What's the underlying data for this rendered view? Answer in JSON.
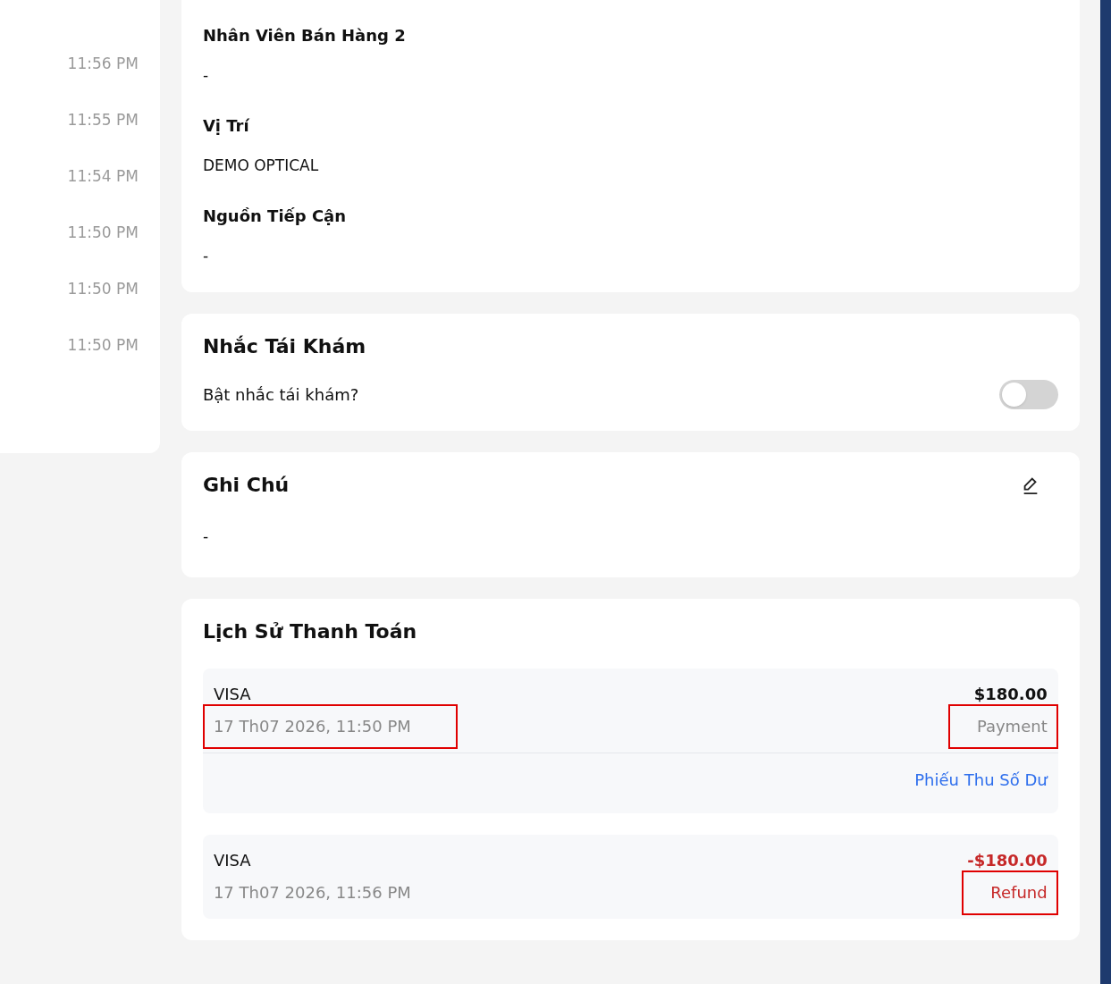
{
  "timeline": {
    "times": [
      "11:56 PM",
      "11:55 PM",
      "11:54 PM",
      "11:50 PM",
      "11:50 PM",
      "11:50 PM"
    ]
  },
  "info": {
    "fields": [
      {
        "label": "Nhân Viên Bán Hàng 2",
        "value": "-"
      },
      {
        "label": "Vị Trí",
        "value": "DEMO OPTICAL"
      },
      {
        "label": "Nguồn Tiếp Cận",
        "value": "-"
      }
    ]
  },
  "reminder": {
    "title": "Nhắc Tái Khám",
    "label": "Bật nhắc tái khám?",
    "on": false
  },
  "notes": {
    "title": "Ghi Chú",
    "value": "-"
  },
  "payments": {
    "title": "Lịch Sử Thanh Toán",
    "items": [
      {
        "kind": "payment",
        "method": "VISA",
        "amount": "$180.00",
        "date": "17 Th07 2026, 11:50 PM",
        "type": "Payment",
        "link": "Phiếu Thu Số Dư",
        "date_marked": true,
        "type_marked": true
      },
      {
        "kind": "refund",
        "method": "VISA",
        "amount": "-$180.00",
        "date": "17 Th07 2026, 11:56 PM",
        "type": "Refund",
        "date_marked": false,
        "type_marked": true
      }
    ]
  }
}
